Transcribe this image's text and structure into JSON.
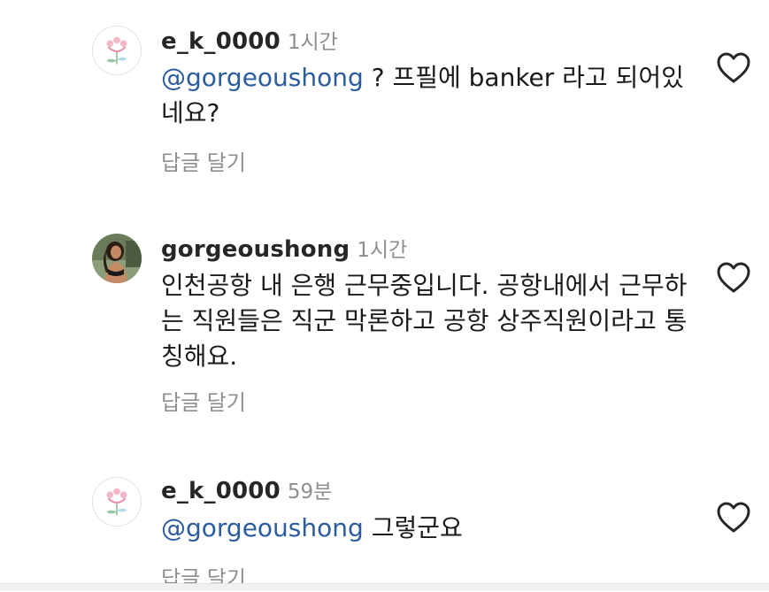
{
  "comments": [
    {
      "avatar": "flower-logo-avatar",
      "username": "e_k_0000",
      "time": "1시간",
      "mention": "@gorgeoushong",
      "text": " ? 프필에 banker 라고 되어있네요?",
      "reply": "답글 달기",
      "like_icon": "heart-outline-icon"
    },
    {
      "avatar": "profile-photo-avatar",
      "username": "gorgeoushong",
      "time": "1시간",
      "mention": "",
      "text": "인천공항 내 은행 근무중입니다. 공항내에서 근무하는 직원들은 직군 막론하고 공항 상주직원이라고 통칭해요.",
      "reply": "답글 달기",
      "like_icon": "heart-outline-icon"
    },
    {
      "avatar": "flower-logo-avatar",
      "username": "e_k_0000",
      "time": "59분",
      "mention": "@gorgeoushong",
      "text": " 그렇군요",
      "reply": "답글 달기",
      "like_icon": "heart-outline-icon"
    }
  ],
  "colors": {
    "mention": "#2a5c9e",
    "secondary_text": "#8e8e8e",
    "primary_text": "#1a1a1a"
  }
}
